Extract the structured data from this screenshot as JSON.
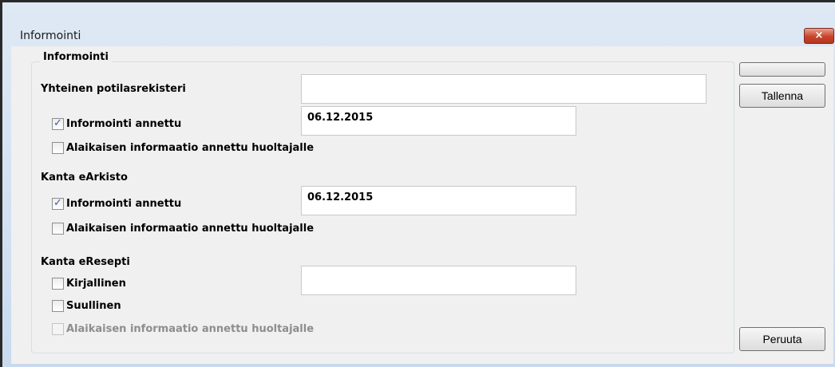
{
  "window": {
    "title": "Informointi",
    "close_glyph": "×"
  },
  "group": {
    "legend": "Informointi"
  },
  "yhteinen": {
    "label": "Yhteinen potilasrekisteri",
    "field_value": "",
    "informointi": {
      "label": "Informointi annettu",
      "checked": true,
      "date": "06.12.2015"
    },
    "alaikaisen": {
      "label": "Alaikaisen informaatio annettu huoltajalle",
      "checked": false
    }
  },
  "earkisto": {
    "label": "Kanta eArkisto",
    "informointi": {
      "label": "Informointi annettu",
      "checked": true,
      "date": "06.12.2015"
    },
    "alaikaisen": {
      "label": "Alaikaisen informaatio annettu huoltajalle",
      "checked": false
    }
  },
  "eresepti": {
    "label": "Kanta eResepti",
    "field_value": "",
    "kirjallinen": {
      "label": "Kirjallinen",
      "checked": false
    },
    "suullinen": {
      "label": "Suullinen",
      "checked": false
    },
    "alaikaisen": {
      "label": "Alaikaisen informaatio annettu huoltajalle",
      "checked": false,
      "disabled": true
    }
  },
  "buttons": {
    "blank_label": "",
    "save_label": "Tallenna",
    "cancel_label": "Peruuta"
  },
  "colors": {
    "title_bar": "#d3e2f3",
    "client_bg": "#f0f0f0",
    "close_button": "#c8442b",
    "check_mark": "#3b57b4"
  }
}
